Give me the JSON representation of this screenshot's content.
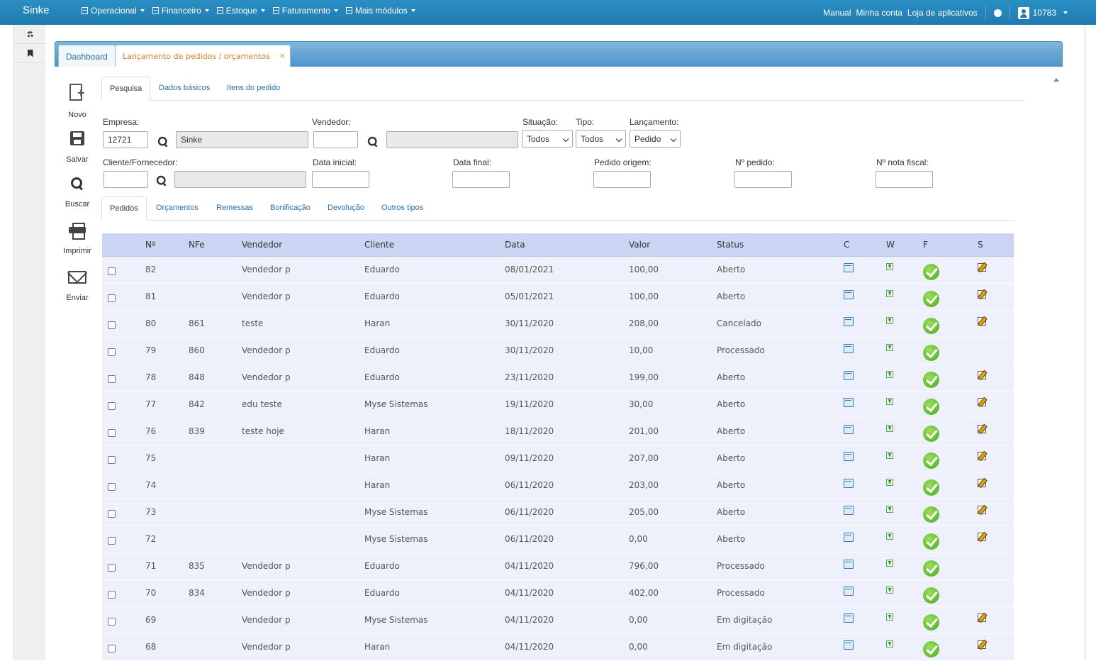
{
  "navbar": {
    "brand": "Sinke",
    "menu": [
      "Operacional",
      "Financeiro",
      "Estoque",
      "Faturamento",
      "Mais módulos"
    ],
    "links": [
      "Manual",
      "Minha conta",
      "Loja de aplicativos"
    ],
    "user": "10783"
  },
  "tabs": {
    "dashboard": "Dashboard",
    "current": "Lançamento de pedidos / orçamentos",
    "close": "×"
  },
  "toolbar": {
    "novo": "Novo",
    "salvar": "Salvar",
    "buscar": "Buscar",
    "imprimir": "Imprimir",
    "enviar": "Enviar"
  },
  "subtabs": [
    "Pesquisa",
    "Dados básicos",
    "Itens do pedido"
  ],
  "form": {
    "empresa_label": "Empresa:",
    "empresa_code": "12721",
    "empresa_name": "Sinke",
    "vendedor_label": "Vendedor:",
    "vendedor_code": "",
    "vendedor_name": "",
    "situacao_label": "Situação:",
    "situacao_value": "Todos",
    "tipo_label": "Tipo:",
    "tipo_value": "Todos",
    "lancamento_label": "Lançamento:",
    "lancamento_value": "Pedido",
    "cliente_label": "Cliente/Fornecedor:",
    "cliente_code": "",
    "cliente_name": "",
    "data_inicial_label": "Data inicial:",
    "data_inicial": "",
    "data_final_label": "Data final:",
    "data_final": "",
    "pedido_origem_label": "Pedido origem:",
    "pedido_origem": "",
    "num_pedido_label": "Nº pedido:",
    "num_pedido": "",
    "nota_fiscal_label": "Nº nota fiscal:",
    "nota_fiscal": ""
  },
  "list_tabs": [
    "Pedidos",
    "Orçamentos",
    "Remessas",
    "Bonificação",
    "Devolução",
    "Outros tipos"
  ],
  "table": {
    "headers": [
      "Nº",
      "NFe",
      "Vendedor",
      "Cliente",
      "Data",
      "Valor",
      "Status",
      "C",
      "W",
      "F",
      "S"
    ],
    "rows": [
      {
        "n": "82",
        "nfe": "",
        "vendedor": "Vendedor p",
        "cliente": "Eduardo",
        "data": "08/01/2021",
        "valor": "100,00",
        "status": "Aberto",
        "s": true
      },
      {
        "n": "81",
        "nfe": "",
        "vendedor": "Vendedor p",
        "cliente": "Eduardo",
        "data": "05/01/2021",
        "valor": "100,00",
        "status": "Aberto",
        "s": true
      },
      {
        "n": "80",
        "nfe": "861",
        "vendedor": "teste",
        "cliente": "Haran",
        "data": "30/11/2020",
        "valor": "208,00",
        "status": "Cancelado",
        "s": true
      },
      {
        "n": "79",
        "nfe": "860",
        "vendedor": "Vendedor p",
        "cliente": "Eduardo",
        "data": "30/11/2020",
        "valor": "10,00",
        "status": "Processado",
        "s": false
      },
      {
        "n": "78",
        "nfe": "848",
        "vendedor": "Vendedor p",
        "cliente": "Eduardo",
        "data": "23/11/2020",
        "valor": "199,00",
        "status": "Aberto",
        "s": true
      },
      {
        "n": "77",
        "nfe": "842",
        "vendedor": "edu teste",
        "cliente": "Myse Sistemas",
        "data": "19/11/2020",
        "valor": "30,00",
        "status": "Aberto",
        "s": true
      },
      {
        "n": "76",
        "nfe": "839",
        "vendedor": "teste hoje",
        "cliente": "Haran",
        "data": "18/11/2020",
        "valor": "201,00",
        "status": "Aberto",
        "s": true
      },
      {
        "n": "75",
        "nfe": "",
        "vendedor": "",
        "cliente": "Haran",
        "data": "09/11/2020",
        "valor": "207,00",
        "status": "Aberto",
        "s": true
      },
      {
        "n": "74",
        "nfe": "",
        "vendedor": "",
        "cliente": "Haran",
        "data": "06/11/2020",
        "valor": "203,00",
        "status": "Aberto",
        "s": true
      },
      {
        "n": "73",
        "nfe": "",
        "vendedor": "",
        "cliente": "Myse Sistemas",
        "data": "06/11/2020",
        "valor": "205,00",
        "status": "Aberto",
        "s": true
      },
      {
        "n": "72",
        "nfe": "",
        "vendedor": "",
        "cliente": "Myse Sistemas",
        "data": "06/11/2020",
        "valor": "0,00",
        "status": "Aberto",
        "s": true
      },
      {
        "n": "71",
        "nfe": "835",
        "vendedor": "Vendedor p",
        "cliente": "Eduardo",
        "data": "04/11/2020",
        "valor": "796,00",
        "status": "Processado",
        "s": false
      },
      {
        "n": "70",
        "nfe": "834",
        "vendedor": "Vendedor p",
        "cliente": "Eduardo",
        "data": "04/11/2020",
        "valor": "402,00",
        "status": "Processado",
        "s": false
      },
      {
        "n": "69",
        "nfe": "",
        "vendedor": "Vendedor p",
        "cliente": "Myse Sistemas",
        "data": "04/11/2020",
        "valor": "0,00",
        "status": "Em digitação",
        "s": true
      },
      {
        "n": "68",
        "nfe": "",
        "vendedor": "Vendedor p",
        "cliente": "Haran",
        "data": "04/11/2020",
        "valor": "0,00",
        "status": "Em digitação",
        "s": true
      }
    ]
  }
}
